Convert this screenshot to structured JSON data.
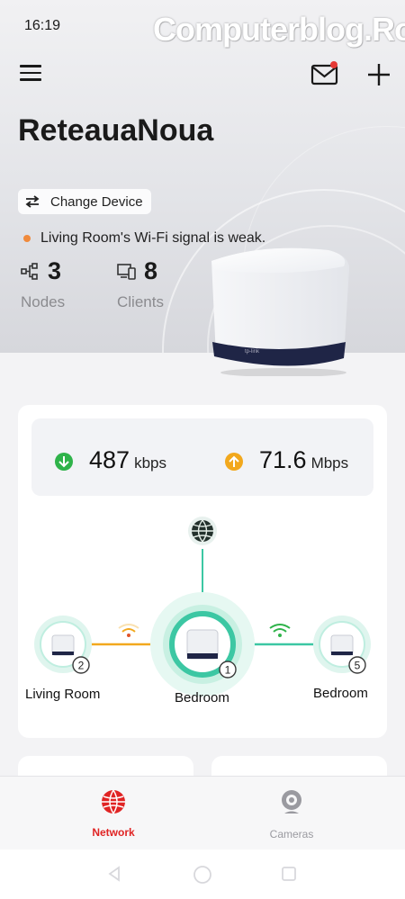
{
  "status_bar": {
    "time": "16:19"
  },
  "watermark": "Computerblog.Ro",
  "header": {
    "network_name": "ReteauaNoua",
    "change_device_label": "Change Device"
  },
  "alert": {
    "message": "Living Room's Wi-Fi signal is weak."
  },
  "stats": {
    "nodes": {
      "value": "3",
      "label": "Nodes"
    },
    "clients": {
      "value": "8",
      "label": "Clients"
    }
  },
  "speeds": {
    "download": {
      "value": "487",
      "unit": "kbps"
    },
    "upload": {
      "value": "71.6",
      "unit": "Mbps"
    }
  },
  "topology": {
    "nodes": [
      {
        "label": "Living Room",
        "badge": "2",
        "signal": "weak"
      },
      {
        "label": "Bedroom",
        "badge": "1",
        "role": "main"
      },
      {
        "label": "Bedroom",
        "badge": "5",
        "signal": "good"
      }
    ]
  },
  "bottom_nav": [
    {
      "label": "Network",
      "active": true
    },
    {
      "label": "Cameras",
      "active": false
    }
  ],
  "colors": {
    "accent_red": "#e02424",
    "download_green": "#2fb34a",
    "upload_orange": "#f2a81d",
    "teal": "#3cc7a3",
    "warn_orange": "#f08a3c"
  },
  "icons": [
    "menu-icon",
    "mail-icon",
    "plus-icon",
    "swap-icon",
    "nodes-icon",
    "clients-icon",
    "download-arrow-icon",
    "upload-arrow-icon",
    "globe-icon",
    "wifi-weak-icon",
    "wifi-strong-icon",
    "network-globe-icon",
    "camera-icon",
    "back-icon",
    "home-icon",
    "recents-icon"
  ]
}
